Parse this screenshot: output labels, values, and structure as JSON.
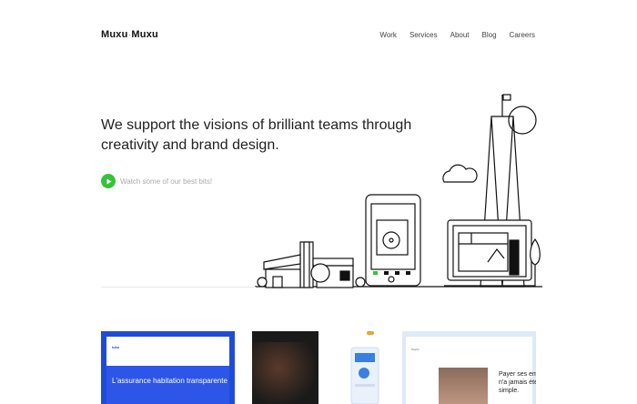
{
  "header": {
    "logo_left": "Muxu",
    "logo_mid": ".",
    "logo_right": "Muxu",
    "nav": [
      {
        "label": "Work"
      },
      {
        "label": "Services"
      },
      {
        "label": "About"
      },
      {
        "label": "Blog"
      },
      {
        "label": "Careers"
      }
    ]
  },
  "hero": {
    "headline": "We support the visions of brilliant teams through creativity and brand design.",
    "watch_label": "Watch some of our best bits!",
    "accent_color": "#36c33b"
  },
  "cards": [
    {
      "title": "L'assurance habitation transparente",
      "brand": "luko",
      "color": "#1f4bd9"
    },
    {
      "color": "#1a1a1a"
    },
    {
      "title": "Payer ses em n'a jamais été simple.",
      "brand": "PayFit",
      "color": "#dfeaf6"
    }
  ]
}
